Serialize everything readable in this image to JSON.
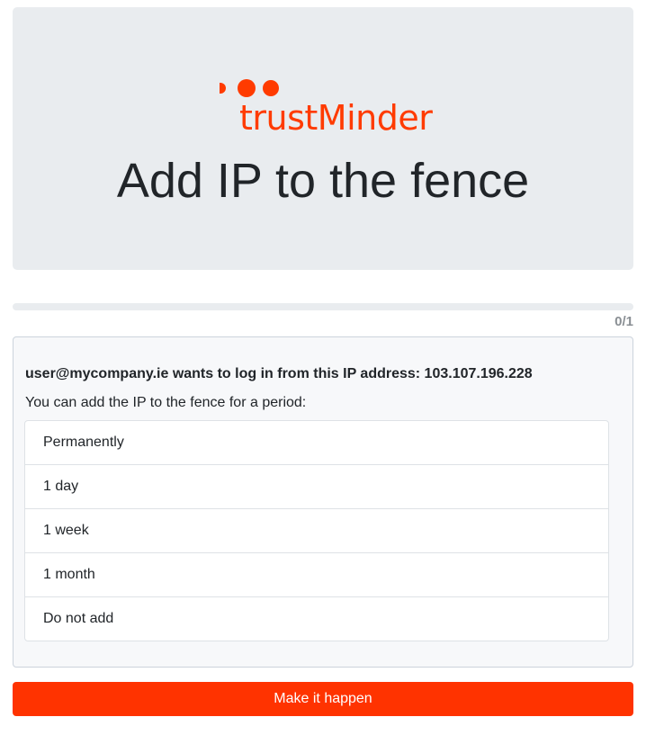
{
  "brand": {
    "name": "trustMinder",
    "accent": "#ff3b00"
  },
  "hero": {
    "title": "Add IP to the fence"
  },
  "progress": {
    "value": 0,
    "counter": "0/1"
  },
  "prompt": {
    "question": "user@mycompany.ie wants to log in from this IP address: 103.107.196.228",
    "instruction": "You can add the IP to the fence for a period:"
  },
  "options": [
    "Permanently",
    "1 day",
    "1 week",
    "1 month",
    "Do not add"
  ],
  "submit_label": "Make it happen"
}
